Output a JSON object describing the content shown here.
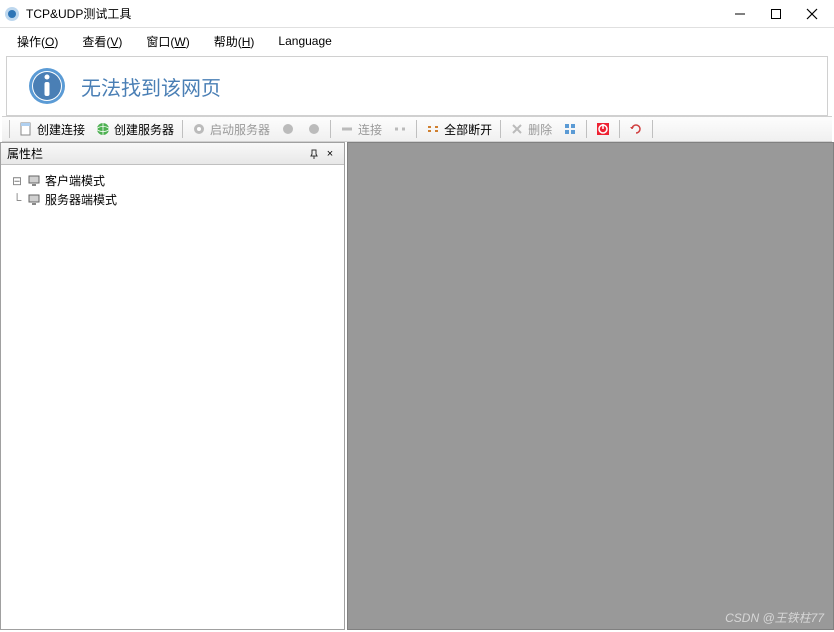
{
  "window": {
    "title": "TCP&UDP测试工具"
  },
  "menu": {
    "items": [
      {
        "label": "操作",
        "key": "O"
      },
      {
        "label": "查看",
        "key": "V"
      },
      {
        "label": "窗口",
        "key": "W"
      },
      {
        "label": "帮助",
        "key": "H"
      },
      {
        "label": "Language",
        "key": ""
      }
    ]
  },
  "banner": {
    "text": "无法找到该网页"
  },
  "toolbar": {
    "create_connection": "创建连接",
    "create_server": "创建服务器",
    "start_server": "启动服务器",
    "connect": "连接",
    "disconnect_all": "全部断开",
    "delete": "删除"
  },
  "sidepanel": {
    "title": "属性栏",
    "tree": {
      "client_mode": "客户端模式",
      "server_mode": "服务器端模式"
    }
  },
  "watermark": "CSDN @王铁柱77"
}
